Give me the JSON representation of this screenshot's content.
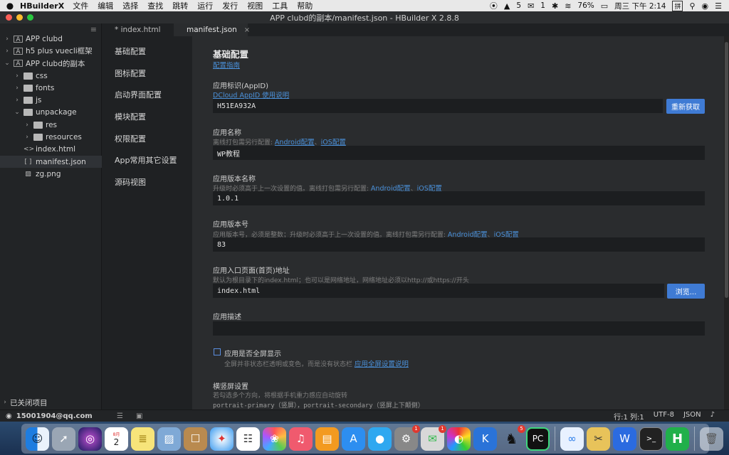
{
  "menubar": {
    "app_name": "HBuilderX",
    "items": [
      "文件",
      "编辑",
      "选择",
      "查找",
      "跳转",
      "运行",
      "发行",
      "视图",
      "工具",
      "帮助"
    ],
    "qq_count": "5",
    "wechat_count": "1",
    "battery": "76%",
    "clock": "周三 下午 2:14",
    "input_method": "拼"
  },
  "window": {
    "title": "APP clubd的副本/manifest.json - HBuilder X 2.8.8"
  },
  "sidebar": {
    "tree": [
      {
        "label": "APP clubd",
        "depth": 0,
        "chev": "›",
        "icon": "project"
      },
      {
        "label": "h5 plus vuecli框架",
        "depth": 0,
        "chev": "›",
        "icon": "project"
      },
      {
        "label": "APP clubd的副本",
        "depth": 0,
        "chev": "⌄",
        "icon": "project"
      },
      {
        "label": "css",
        "depth": 1,
        "chev": "›",
        "icon": "folder"
      },
      {
        "label": "fonts",
        "depth": 1,
        "chev": "›",
        "icon": "folder"
      },
      {
        "label": "js",
        "depth": 1,
        "chev": "›",
        "icon": "folder"
      },
      {
        "label": "unpackage",
        "depth": 1,
        "chev": "⌄",
        "icon": "folder"
      },
      {
        "label": "res",
        "depth": 2,
        "chev": "›",
        "icon": "folder"
      },
      {
        "label": "resources",
        "depth": 2,
        "chev": "›",
        "icon": "folder"
      },
      {
        "label": "index.html",
        "depth": 1,
        "chev": "",
        "icon": "html"
      },
      {
        "label": "manifest.json",
        "depth": 1,
        "chev": "",
        "icon": "json",
        "selected": true
      },
      {
        "label": "zg.png",
        "depth": 1,
        "chev": "",
        "icon": "image"
      }
    ],
    "closed_projects": "已关闭项目"
  },
  "tabs": [
    {
      "label": "* index.html",
      "active": false
    },
    {
      "label": "manifest.json",
      "active": true,
      "close": "×"
    }
  ],
  "settings_nav": [
    "基础配置",
    "图标配置",
    "启动界面配置",
    "模块配置",
    "权限配置",
    "App常用其它设置",
    "源码视图"
  ],
  "main": {
    "title": "基础配置",
    "guide_link": "配置指南",
    "appid": {
      "label": "应用标识(AppID)",
      "link": "DCloud AppID 使用说明",
      "value": "H51EA932A",
      "button": "重新获取"
    },
    "appname": {
      "label": "应用名称",
      "hint": "离线打包需另行配置:",
      "android": "Android配置",
      "sep": "、",
      "ios": "iOS配置",
      "value": "WP教程"
    },
    "version_name": {
      "label": "应用版本名称",
      "hint": "升级时必须高于上一次设置的值。离线打包需另行配置:",
      "android": "Android配置",
      "sep": "、",
      "ios": "iOS配置",
      "value": "1.0.1"
    },
    "version_code": {
      "label": "应用版本号",
      "hint": "应用版本号，必须是整数；升级时必须高于上一次设置的值。离线打包需另行配置:",
      "android": "Android配置",
      "sep": "、",
      "ios": "iOS配置",
      "value": "83"
    },
    "entry": {
      "label": "应用入口页面(首页)地址",
      "hint": "默认为根目录下的index.html；也可以是网络地址，网络地址必须以http://或https://开头",
      "value": "index.html",
      "button": "浏览..."
    },
    "desc": {
      "label": "应用描述",
      "value": ""
    },
    "fullscreen": {
      "label": "应用是否全屏显示",
      "hint": "全屏并非状态栏透明或变色，而是没有状态栏",
      "link": "应用全屏设置说明",
      "checked": false
    },
    "orientation": {
      "label": "横竖屏设置",
      "hint": "若勾选多个方向，将根据手机重力感应自动旋转",
      "value": "portrait-primary（竖屏），portrait-secondary（竖屏上下颠倒）"
    }
  },
  "status": {
    "user": "15001904@qq.com",
    "position": "行:1  列:1",
    "encoding": "UTF-8",
    "language": "JSON"
  },
  "dock": {
    "calendar_month": "8月",
    "calendar_day": "2",
    "badge_settings": "1",
    "badge_wechat": "1",
    "badge_qq": "5"
  }
}
